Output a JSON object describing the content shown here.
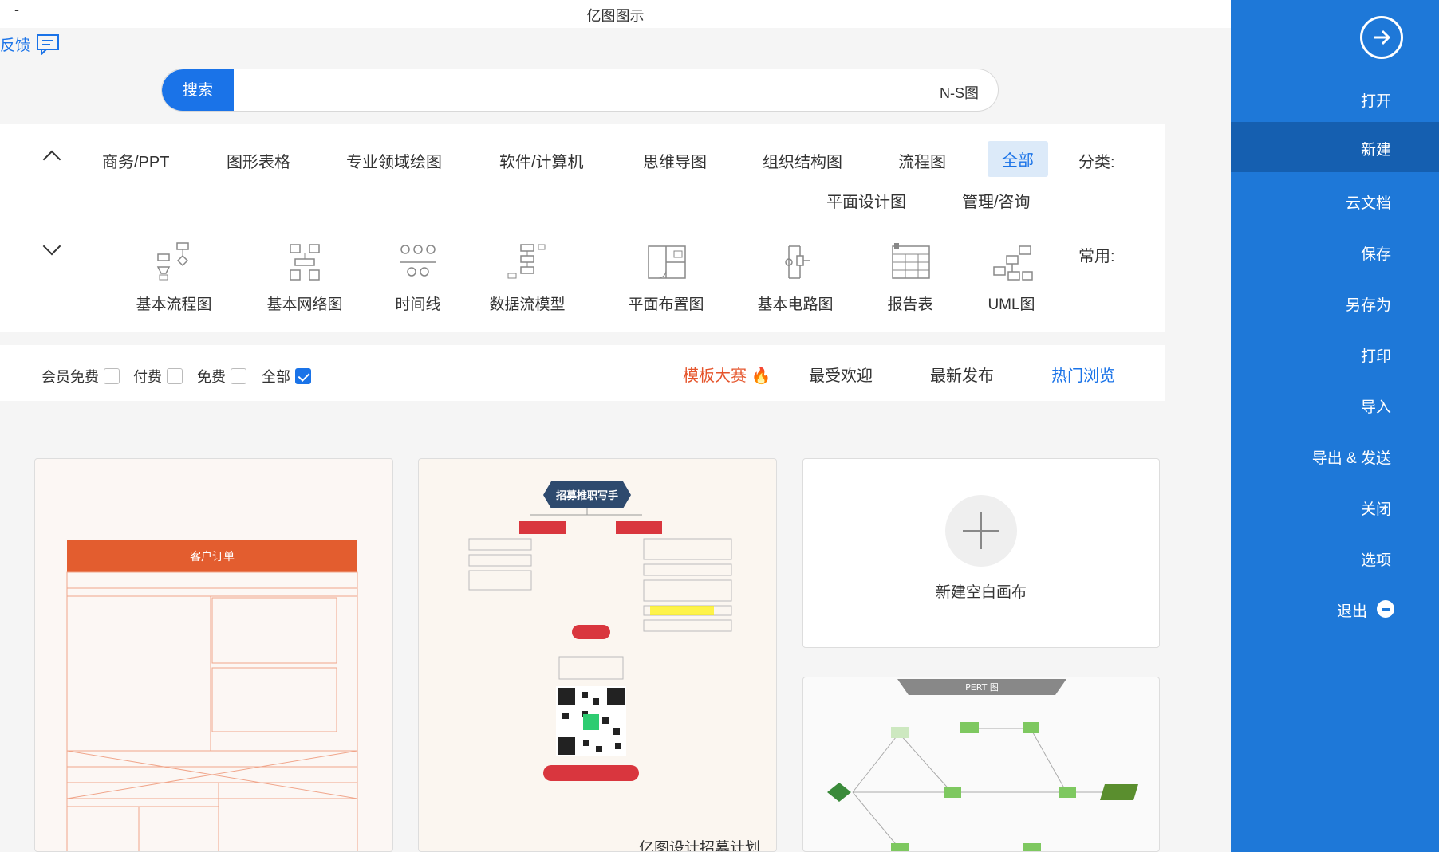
{
  "app": {
    "title": "亿图图示",
    "minimize": "-",
    "feedback": "反馈"
  },
  "sidebar": {
    "items": [
      {
        "label": "打开"
      },
      {
        "label": "新建"
      },
      {
        "label": "云文档"
      },
      {
        "label": "保存"
      },
      {
        "label": "另存为"
      },
      {
        "label": "打印"
      },
      {
        "label": "导入"
      },
      {
        "label": "导出 & 发送"
      },
      {
        "label": "关闭"
      },
      {
        "label": "选项"
      },
      {
        "label": "退出"
      }
    ]
  },
  "search": {
    "button": "搜索",
    "value": "N-S图"
  },
  "categories": {
    "label": "分类:",
    "items": [
      "全部",
      "流程图",
      "组织结构图",
      "思维导图",
      "软件/计算机",
      "专业领域绘图",
      "图形表格",
      "商务/PPT",
      "管理/咨询",
      "平面设计图"
    ]
  },
  "common": {
    "label": "常用:",
    "items": [
      "UML图",
      "报告表",
      "基本电路图",
      "平面布置图",
      "数据流模型",
      "时间线",
      "基本网络图",
      "基本流程图"
    ]
  },
  "tabs": [
    "热门浏览",
    "最新发布",
    "最受欢迎",
    "模板大赛"
  ],
  "filters": [
    "全部",
    "免费",
    "付费",
    "会员免费"
  ],
  "cards": {
    "new_blank": "新建空白画布",
    "mindmap_title": "招募推职写手",
    "mindmap_footer": "亿图设计招募计划",
    "order_title": "客户订单",
    "pert_title": "PERT 图"
  },
  "colors": {
    "accent": "#1a73e8",
    "sidebar": "#1e78d8",
    "sidebar_active": "#155fb0",
    "contest": "#e5542b"
  }
}
